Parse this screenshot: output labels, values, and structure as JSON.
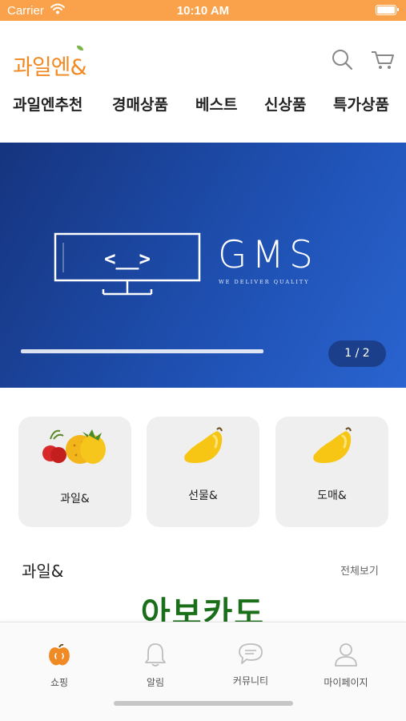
{
  "status_bar": {
    "carrier": "Carrier",
    "time": "10:10 AM"
  },
  "header": {
    "logo_text": "과일엔&"
  },
  "nav": {
    "tabs": [
      "과일엔추천",
      "경매상품",
      "베스트",
      "신상품",
      "특가상품"
    ]
  },
  "banner": {
    "title": "GMS",
    "subtitle": "WE DELIVER QUALITY",
    "code_glyph": "<__>",
    "counter": "1 / 2",
    "progress": 0.5
  },
  "categories": [
    {
      "label": "과일&",
      "icon": "fruit-icon"
    },
    {
      "label": "선물&",
      "icon": "mango-icon"
    },
    {
      "label": "도매&",
      "icon": "mango-icon"
    }
  ],
  "section": {
    "title": "과일&",
    "more_label": "전체보기"
  },
  "product": {
    "title": "아보카도"
  },
  "tab_bar": {
    "items": [
      {
        "label": "쇼핑",
        "icon": "apple-icon",
        "active": true
      },
      {
        "label": "알림",
        "icon": "bell-icon",
        "active": false
      },
      {
        "label": "커뮤니티",
        "icon": "chat-bubble-icon",
        "active": false
      },
      {
        "label": "마이페이지",
        "icon": "person-icon",
        "active": false
      }
    ]
  },
  "colors": {
    "status_bar": "#f9a24b",
    "logo": "#f08a24",
    "active_tab": "#f08a24",
    "product_title": "#1b6e1a",
    "banner_blue": "#1e4fb0"
  }
}
